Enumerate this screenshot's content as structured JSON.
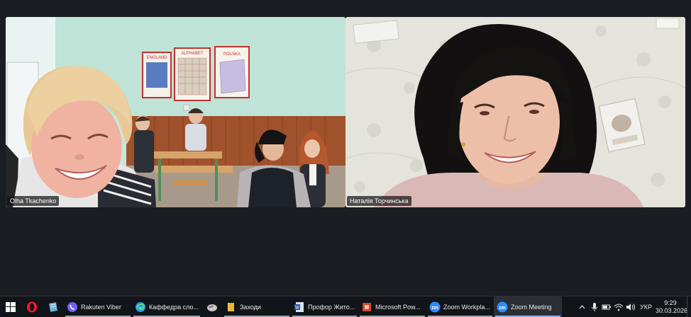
{
  "participants": [
    {
      "name": "Olha Tkachenko"
    },
    {
      "name": "Наталія Торчинська"
    }
  ],
  "classroom_posters": [
    "ENGLAND",
    "ALPHABET",
    "POLSKA"
  ],
  "taskbar": {
    "apps": [
      {
        "label": "Rakuten Viber",
        "icon": "viber-icon",
        "color": "#7360f2"
      },
      {
        "label": "Каффедра сло...",
        "icon": "edge-icon",
        "color": "#1fa0d8"
      },
      {
        "label": "Заходи",
        "icon": "folder-icon",
        "color": "#f2c94c"
      },
      {
        "label": "Профор Жито...",
        "icon": "word-doc-icon",
        "color": "#2b579a"
      },
      {
        "label": "Microsoft Pow...",
        "icon": "powerpoint-icon",
        "color": "#d24726"
      },
      {
        "label": "Zoom Workpla...",
        "icon": "zoom-icon",
        "color": "#2d8cff"
      },
      {
        "label": "Zoom Meeting",
        "icon": "zoom-icon",
        "color": "#2d8cff"
      }
    ],
    "pinned": [
      {
        "icon": "opera-icon",
        "color": "#ff1b2d"
      },
      {
        "icon": "notepad-icon",
        "color": "#4fa3d1"
      },
      {
        "icon": "paint-icon",
        "color": "#c7c7c7"
      }
    ],
    "tray": {
      "language": "УКР",
      "time": "9:29",
      "date": "30.03.2026"
    }
  }
}
